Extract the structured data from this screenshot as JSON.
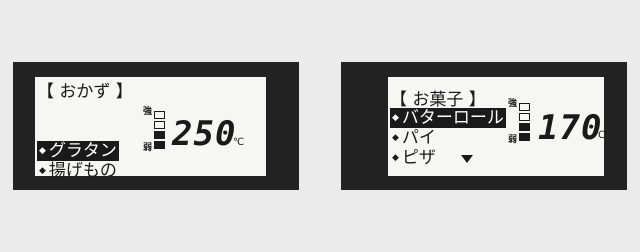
{
  "panels": [
    {
      "title": "【 おかず 】",
      "items": [
        {
          "label": "グラタン",
          "selected": true
        },
        {
          "label": "揚げもの",
          "selected": false
        }
      ],
      "level": {
        "strong_label": "強",
        "weak_label": "弱",
        "total_bars": 4,
        "filled_bars": 2
      },
      "temperature": "250",
      "unit": "℃"
    },
    {
      "title": "【 お菓子 】",
      "items": [
        {
          "label": "バターロール",
          "selected": true
        },
        {
          "label": "パイ",
          "selected": false
        },
        {
          "label": "ピザ",
          "selected": false
        }
      ],
      "more_indicator": "down-triangle-icon",
      "level": {
        "strong_label": "強",
        "weak_label": "弱",
        "total_bars": 4,
        "filled_bars": 2
      },
      "temperature": "170",
      "unit": "℃"
    }
  ]
}
